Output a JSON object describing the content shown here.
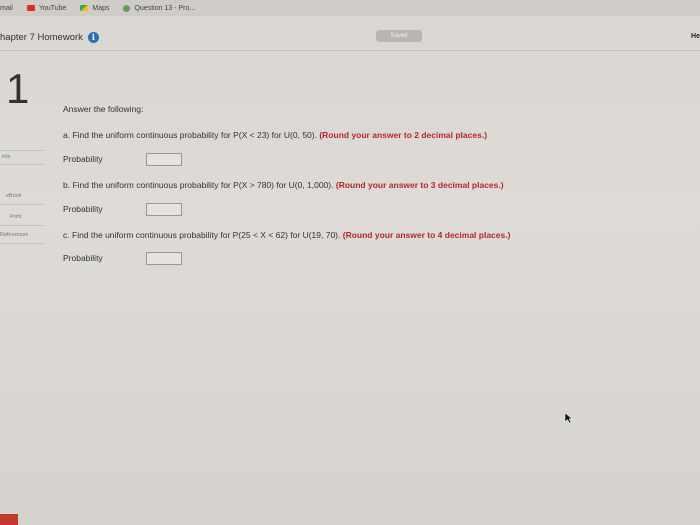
{
  "bookmarks": [
    {
      "label": "mail",
      "icon": "mail-icon"
    },
    {
      "label": "YouTube",
      "icon": "youtube-icon"
    },
    {
      "label": "Maps",
      "icon": "maps-icon"
    },
    {
      "label": "Question 13 - Pro...",
      "icon": "site-icon"
    }
  ],
  "header": {
    "title": "hapter 7 Homework",
    "saved": "Saved",
    "help": "He"
  },
  "question": {
    "number": "1",
    "intro": "Answer the following:",
    "parts": [
      {
        "prefix": "a.",
        "text": "Find the uniform continuous probability for P(X < 23) for U(0, 50).",
        "instruction": "(Round your answer to 2 decimal places.)",
        "label": "Probability",
        "value": ""
      },
      {
        "prefix": "b.",
        "text": "Find the uniform continuous probability for P(X > 780) for U(0, 1,000).",
        "instruction": "(Round your answer to 3 decimal places.)",
        "label": "Probability",
        "value": ""
      },
      {
        "prefix": "c.",
        "text": "Find the uniform continuous probability for P(25 < X < 62) for U(19, 70).",
        "instruction": "(Round your answer to 4 decimal places.)",
        "label": "Probability",
        "value": ""
      }
    ]
  },
  "sidebar": {
    "points": "ints",
    "ebook": "eBook",
    "print": "Print",
    "references": "References"
  },
  "colors": {
    "accent_red": "#b3272d",
    "info_blue": "#2a6fb5"
  }
}
